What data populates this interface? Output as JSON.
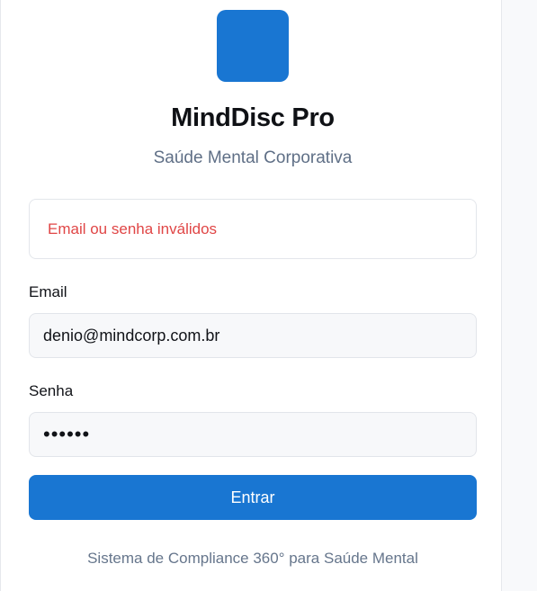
{
  "colors": {
    "accent": "#1976d2",
    "error": "#e04646"
  },
  "brand": {
    "logo_icon": "app-logo-square",
    "title": "MindDisc Pro",
    "subtitle": "Saúde Mental Corporativa"
  },
  "alert": {
    "message": "Email ou senha inválidos"
  },
  "form": {
    "email_label": "Email",
    "email_value": "denio@mindcorp.com.br",
    "password_label": "Senha",
    "password_value": "••••••",
    "submit_label": "Entrar"
  },
  "footer": {
    "text": "Sistema de Compliance 360° para Saúde Mental"
  }
}
